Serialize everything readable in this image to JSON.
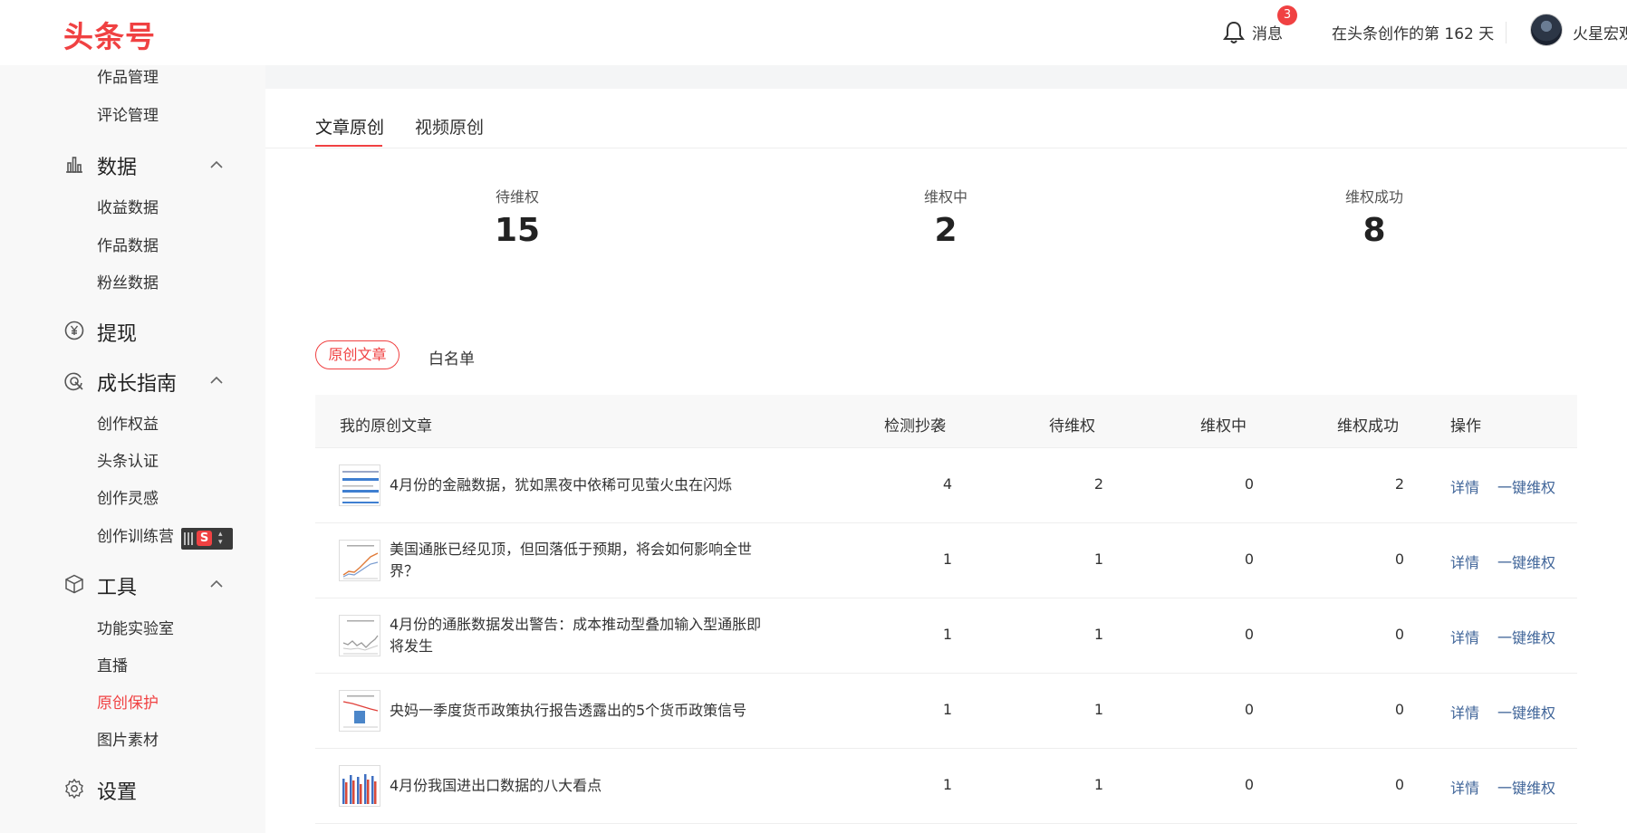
{
  "header": {
    "logo": "头条号",
    "notification_count": "3",
    "messages_label": "消息",
    "days_text": "在头条创作的第 162 天",
    "username": "火星宏观"
  },
  "sidebar": {
    "items": [
      {
        "label": "作品管理",
        "type": "sub"
      },
      {
        "label": "评论管理",
        "type": "sub"
      },
      {
        "label": "数据",
        "type": "section",
        "icon": "bar-chart-icon"
      },
      {
        "label": "收益数据",
        "type": "sub"
      },
      {
        "label": "作品数据",
        "type": "sub"
      },
      {
        "label": "粉丝数据",
        "type": "sub"
      },
      {
        "label": "提现",
        "type": "section",
        "icon": "yuan-icon"
      },
      {
        "label": "成长指南",
        "type": "section",
        "icon": "growth-icon"
      },
      {
        "label": "创作权益",
        "type": "sub"
      },
      {
        "label": "头条认证",
        "type": "sub"
      },
      {
        "label": "创作灵感",
        "type": "sub"
      },
      {
        "label": "创作训练营",
        "type": "sub"
      },
      {
        "label": "工具",
        "type": "section",
        "icon": "cube-icon"
      },
      {
        "label": "功能实验室",
        "type": "sub"
      },
      {
        "label": "直播",
        "type": "sub"
      },
      {
        "label": "原创保护",
        "type": "sub",
        "active": true
      },
      {
        "label": "图片素材",
        "type": "sub"
      },
      {
        "label": "设置",
        "type": "section",
        "icon": "gear-icon"
      }
    ]
  },
  "tabs": [
    {
      "label": "文章原创",
      "active": true
    },
    {
      "label": "视频原创",
      "active": false
    }
  ],
  "stats": [
    {
      "label": "待维权",
      "value": "15"
    },
    {
      "label": "维权中",
      "value": "2"
    },
    {
      "label": "维权成功",
      "value": "8"
    }
  ],
  "filter": {
    "active": "原创文章",
    "other": "白名单"
  },
  "table": {
    "headers": [
      "我的原创文章",
      "检测抄袭",
      "待维权",
      "维权中",
      "维权成功",
      "操作"
    ],
    "rows": [
      {
        "title": "4月份的金融数据，犹如黑夜中依稀可见萤火虫在闪烁",
        "detected": "4",
        "pending": "2",
        "in_progress": "0",
        "success": "2",
        "thumb": "table"
      },
      {
        "title": "美国通胀已经见顶，但回落低于预期，将会如何影响全世界？",
        "detected": "1",
        "pending": "1",
        "in_progress": "0",
        "success": "0",
        "thumb": "line"
      },
      {
        "title": "4月份的通胀数据发出警告：成本推动型叠加输入型通胀即将发生",
        "detected": "1",
        "pending": "1",
        "in_progress": "0",
        "success": "0",
        "thumb": "line"
      },
      {
        "title": "央妈一季度货币政策执行报告透露出的5个货币政策信号",
        "detected": "1",
        "pending": "1",
        "in_progress": "0",
        "success": "0",
        "thumb": "bar-line"
      },
      {
        "title": "4月份我国进出口数据的八大看点",
        "detected": "1",
        "pending": "1",
        "in_progress": "0",
        "success": "0",
        "thumb": "bars"
      }
    ],
    "action_detail": "详情",
    "action_claim": "一键维权"
  },
  "colors": {
    "brand": "#f04142",
    "link": "#406599"
  }
}
